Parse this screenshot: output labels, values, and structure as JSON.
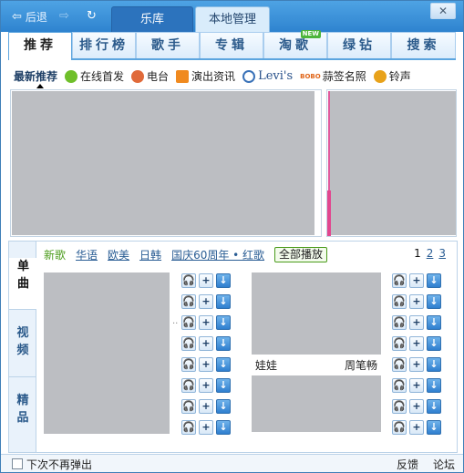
{
  "titlebar": {
    "back_label": "后退",
    "tabs": [
      {
        "label": "乐库",
        "active": true
      },
      {
        "label": "本地管理",
        "active": false
      }
    ],
    "close_symbol": "✕"
  },
  "main_tabs": [
    {
      "label": "推荐",
      "active": true
    },
    {
      "label": "排行榜",
      "active": false
    },
    {
      "label": "歌手",
      "active": false
    },
    {
      "label": "专辑",
      "active": false
    },
    {
      "label": "淘歌",
      "active": false,
      "badge": "NEW"
    },
    {
      "label": "绿钻",
      "active": false
    },
    {
      "label": "搜索",
      "active": false
    }
  ],
  "subnav": {
    "lead": "最新推荐",
    "items": [
      {
        "label": "在线首发",
        "icon": "online-release-icon",
        "color": "#6fbf2a"
      },
      {
        "label": "电台",
        "icon": "radio-avatar-icon",
        "color": "#e06a3a"
      },
      {
        "label": "演出资讯",
        "icon": "show-info-icon",
        "color": "#f08a1f"
      },
      {
        "label": "Levi's",
        "icon": "levis-icon",
        "color": "#3a72b8"
      },
      {
        "label": "蒜签名照",
        "prefix": "BOBO",
        "icon": "bobo-icon",
        "color": "#e0661a"
      },
      {
        "label": "铃声",
        "icon": "ringtone-icon",
        "color": "#e8a21a"
      }
    ]
  },
  "side_tabs": [
    {
      "label": "单曲",
      "active": true
    },
    {
      "label": "视频",
      "active": false
    },
    {
      "label": "精品",
      "active": false
    }
  ],
  "lang_tabs": {
    "items": [
      {
        "label": "新歌",
        "active": true
      },
      {
        "label": "华语",
        "active": false
      },
      {
        "label": "欧美",
        "active": false
      },
      {
        "label": "日韩",
        "active": false
      },
      {
        "label": "国庆60周年 • 红歌",
        "active": false
      }
    ],
    "play_all": "全部播放"
  },
  "pager": [
    "1",
    "2",
    "3"
  ],
  "album_card": {
    "left_artist": "娃娃",
    "right_artist": "周笔畅"
  },
  "song_buttons": {
    "listen": "🎧",
    "add": "+",
    "download": "↓"
  },
  "footer": {
    "checkbox_label": "下次不再弹出",
    "feedback": "反馈",
    "forum": "论坛"
  },
  "colors": {
    "accent": "#2e83cf",
    "tab_text": "#2b5a8b",
    "link": "#2a5d94",
    "green": "#4a9b1a"
  }
}
